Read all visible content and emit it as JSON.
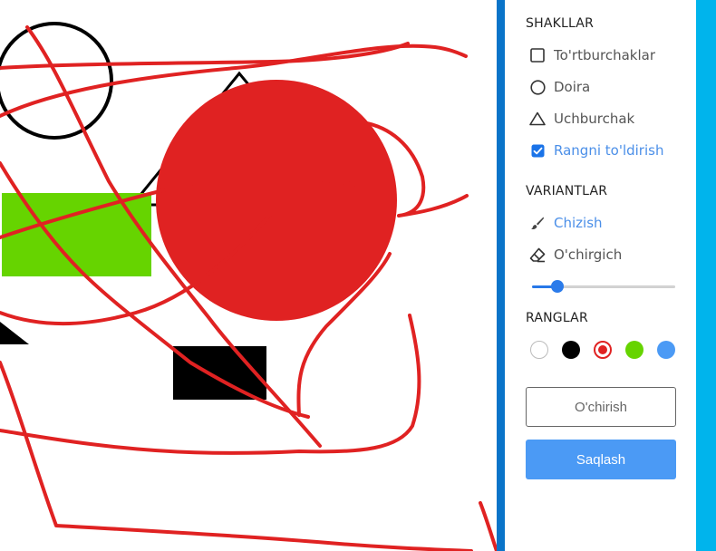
{
  "colors": {
    "divider": "#0a74c9",
    "right_strip": "#00b4ec",
    "accent": "#4b8fe8",
    "save_button": "#4b9af5",
    "stroke_red": "#e02222",
    "fill_red": "#e02222",
    "fill_green": "#66d400",
    "fill_black": "#000000"
  },
  "panel": {
    "shapes_title": "SHAKLLAR",
    "shapes": [
      {
        "label": "To'rtburchaklar",
        "icon": "square-icon"
      },
      {
        "label": "Doira",
        "icon": "circle-icon"
      },
      {
        "label": "Uchburchak",
        "icon": "triangle-icon"
      }
    ],
    "fill_toggle": {
      "label": "Rangni to'ldirish",
      "checked": true
    },
    "options_title": "VARIANTLAR",
    "tools": [
      {
        "label": "Chizish",
        "icon": "brush-icon",
        "active": true
      },
      {
        "label": "O'chirgich",
        "icon": "eraser-icon",
        "active": false
      }
    ],
    "brush_size_fraction": 0.18,
    "colors_title": "RANGLAR",
    "palette": [
      {
        "name": "white",
        "hex": "#ffffff",
        "selected": false
      },
      {
        "name": "black",
        "hex": "#000000",
        "selected": false
      },
      {
        "name": "red",
        "hex": "#e02222",
        "selected": true
      },
      {
        "name": "green",
        "hex": "#66d400",
        "selected": false
      },
      {
        "name": "blue",
        "hex": "#4b9af5",
        "selected": false
      }
    ],
    "clear_label": "O'chirish",
    "save_label": "Saqlash"
  }
}
